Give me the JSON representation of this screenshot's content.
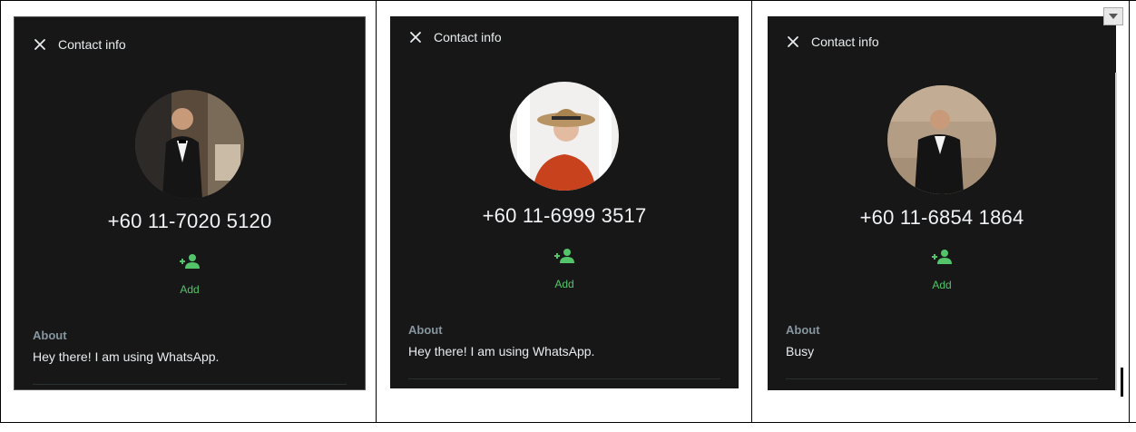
{
  "panels": [
    {
      "header_title": "Contact info",
      "phone": "+60 11-7020 5120",
      "add_label": "Add",
      "about_label": "About",
      "about_text": "Hey there! I am using WhatsApp.",
      "avatar_desc": "man-in-tuxedo"
    },
    {
      "header_title": "Contact info",
      "phone": "+60 11-6999 3517",
      "add_label": "Add",
      "about_label": "About",
      "about_text": "Hey there! I am using WhatsApp.",
      "avatar_desc": "woman-in-straw-hat"
    },
    {
      "header_title": "Contact info",
      "phone": "+60 11-6854 1864",
      "add_label": "Add",
      "about_label": "About",
      "about_text": "Busy",
      "avatar_desc": "man-in-suit"
    }
  ],
  "icons": {
    "close": "close-icon",
    "add": "add-contact-icon",
    "dropdown": "chevron-down-icon"
  },
  "colors": {
    "panel_bg": "#171717",
    "accent_green": "#54c46b",
    "text_primary": "#e9edef",
    "text_secondary": "#8696a0"
  }
}
